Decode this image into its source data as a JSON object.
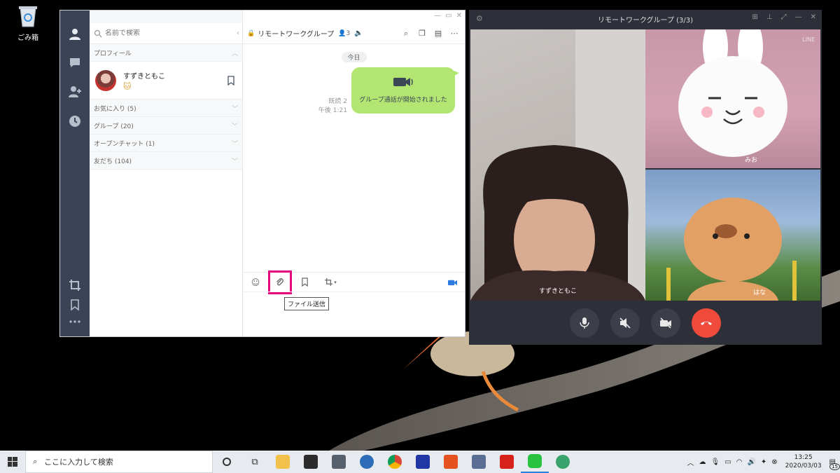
{
  "desktop": {
    "recycle_bin_label": "ごみ箱"
  },
  "line_window": {
    "search": {
      "placeholder": "名前で検索"
    },
    "profile_section": "プロフィール",
    "profile": {
      "name": "すずきともこ",
      "emoji": "🐱"
    },
    "sections": [
      {
        "label": "お気に入り (5)"
      },
      {
        "label": "グループ (20)"
      },
      {
        "label": "オープンチャット (1)"
      },
      {
        "label": "友だち (104)"
      }
    ],
    "chat": {
      "title": "リモートワークグループ",
      "member_count": "3",
      "date_chip": "今日",
      "read_status": "既読 2",
      "time": "午後 1:21",
      "message": "グループ通話が開始されました"
    },
    "tooltip": "ファイル送信",
    "icons": {
      "nav": [
        "person-icon",
        "chat-icon",
        "add-friend-icon",
        "clock-icon",
        "crop-icon",
        "bookmark-icon",
        "more-icon"
      ],
      "toolbar": [
        "emoji-icon",
        "paperclip-icon",
        "bookmark-icon",
        "crop-icon",
        "send-media-icon"
      ]
    }
  },
  "call_window": {
    "title": "リモートワークグループ (3/3)",
    "participants": [
      {
        "name": "すずきともこ"
      },
      {
        "name": "みお"
      },
      {
        "name": "はな"
      }
    ],
    "watermark": "LINE"
  },
  "taskbar": {
    "search_placeholder": "ここに入力して検索",
    "time": "13:25",
    "date": "2020/03/03",
    "notifications": "15"
  },
  "colors": {
    "line_green": "#b3e573",
    "nav_dark": "#3b4456",
    "highlight_pink": "#e6007e",
    "hangup_red": "#f04a3c"
  }
}
